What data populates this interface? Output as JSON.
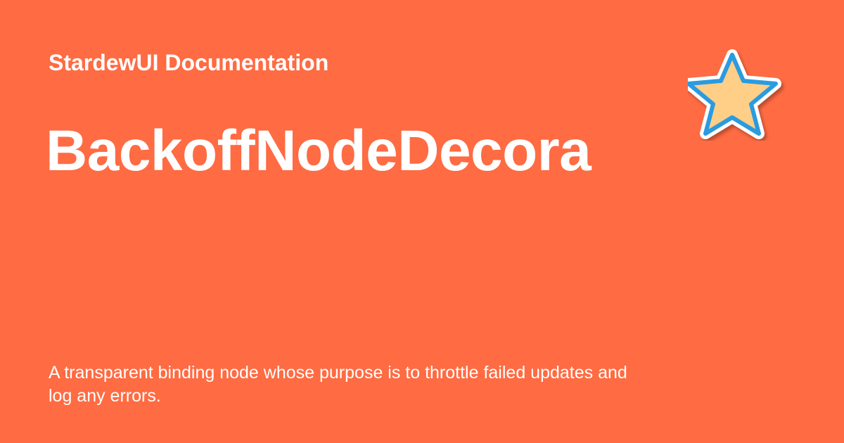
{
  "theme": {
    "background_color": "#ff6b42",
    "text_color": "#ffffff",
    "logo_fill_color": "#ffcf87",
    "logo_outline_color": "#2a9be0",
    "logo_icon": "star-icon"
  },
  "card": {
    "site_name": "StardewUI Documentation",
    "title": "BackoffNodeDecora",
    "description": "A transparent binding node whose purpose is to throttle failed updates and log any errors."
  }
}
